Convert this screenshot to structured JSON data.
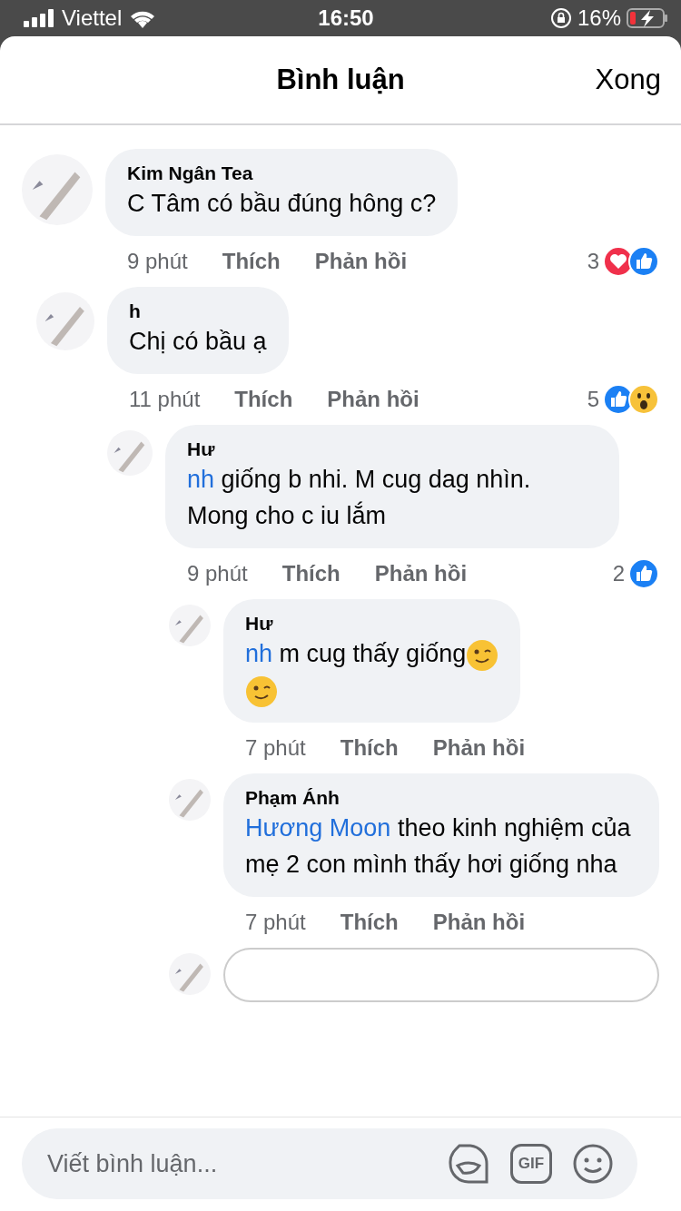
{
  "status_bar": {
    "carrier": "Viettel",
    "time": "16:50",
    "battery": "16%"
  },
  "header": {
    "title": "Bình luận",
    "done": "Xong"
  },
  "comments": [
    {
      "name": "Kim Ngân Tea",
      "text": "C Tâm có bầu đúng hông c?",
      "time": "9 phút",
      "like": "Thích",
      "reply": "Phản hồi",
      "reaction_count": "3",
      "reactions": [
        {
          "kind": "heart"
        },
        {
          "kind": "like"
        }
      ]
    },
    {
      "name": "h",
      "text": "Chị có bầu ạ",
      "time": "11 phút",
      "like": "Thích",
      "reply": "Phản hồi",
      "reaction_count": "5",
      "reactions": [
        {
          "kind": "like"
        },
        {
          "kind": "wow"
        }
      ],
      "children": [
        {
          "name": "Hư",
          "mention": "nh",
          "text": "giống b nhi. M cug dag nhìn. Mong cho c iu lắm",
          "time": "9 phút",
          "like": "Thích",
          "reply": "Phản hồi",
          "reaction_count": "2",
          "reactions": [
            {
              "kind": "like"
            }
          ],
          "children": [
            {
              "name": "Hư",
              "mention": "nh",
              "text": "m cug thấy giống",
              "trailing_emoji": [
                {
                  "kind": "wink"
                }
              ],
              "emoji_line": [
                {
                  "kind": "wink"
                }
              ],
              "time": "7 phút",
              "like": "Thích",
              "reply": "Phản hồi"
            },
            {
              "name": "Phạm Ánh",
              "mention": "Hương Moon",
              "text": "theo kinh nghiệm của mẹ 2 con mình thấy hơi giống nha",
              "time": "7 phút",
              "like": "Thích",
              "reply": "Phản hồi"
            }
          ]
        }
      ]
    }
  ],
  "composer": {
    "placeholder": "Viết bình luận...",
    "gif": "GIF"
  }
}
